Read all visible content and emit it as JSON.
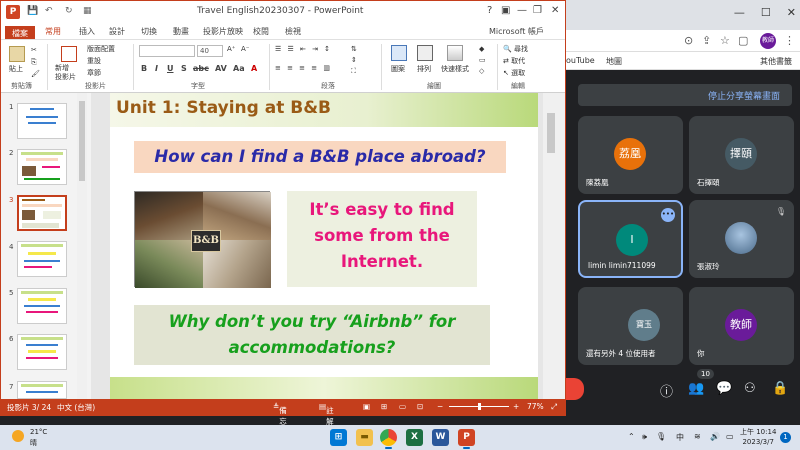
{
  "ppt": {
    "window_title": "Travel English20230307 - PowerPoint",
    "logo": "P",
    "qa_icons": [
      "save-icon",
      "undo-icon",
      "redo-icon",
      "present-icon"
    ],
    "title_help": "?",
    "tabs": [
      "檔案",
      "常用",
      "插入",
      "設計",
      "切換",
      "動畫",
      "投影片放映",
      "校閱",
      "檢視"
    ],
    "account": "Microsoft 帳戶",
    "ribbon": {
      "paste": "貼上",
      "new_slide": "新增\n投影片",
      "layout": "版面配置",
      "reset": "重設",
      "section": "章節",
      "font_size": "40",
      "shapes": "圖案",
      "arrange": "排列",
      "quick_styles": "快速樣式",
      "find": "尋找",
      "replace": "取代",
      "select": "選取",
      "groups": [
        "剪貼簿",
        "投影片",
        "字型",
        "段落",
        "繪圖",
        "編輯"
      ],
      "format_buttons": [
        "B",
        "I",
        "U",
        "S",
        "abc",
        "AV",
        "Aa"
      ]
    },
    "slide_numbers": [
      "1",
      "2",
      "3",
      "4",
      "5",
      "6",
      "7"
    ],
    "slide": {
      "title": "Unit 1: Staying at B&B",
      "question1": "How can I find a B&B place abroad?",
      "answer_line1": "It’s easy to find",
      "answer_line2": "some from the",
      "answer_line3": "Internet.",
      "question2_line1": "Why don’t you try “Airbnb” for",
      "question2_line2": "accommodations?",
      "sign": "B&B"
    },
    "status": {
      "slide_info": "投影片 3/ 24",
      "language": "中文 (台灣)",
      "notes": "備忘稿",
      "comments": "註解",
      "zoom": "77%",
      "zoom_fraction": 0.5
    }
  },
  "meet": {
    "tab_title": "教師",
    "bookmarks": [
      "ouTube",
      "地圖",
      "其他書籤"
    ],
    "stop_share": "停止分享螢幕畫面",
    "participants": [
      {
        "avatar": "荔凰",
        "name": "陳荔凰",
        "color": "#e8710a"
      },
      {
        "avatar": "擇頤",
        "name": "石擇頤",
        "color": "#455a64"
      },
      {
        "avatar": "I",
        "name": "limin limin711099",
        "color": "#00897b"
      },
      {
        "avatar": "",
        "name": "張淑玲",
        "color": "#5d7fa8"
      },
      {
        "avatar": "寶玉",
        "name": "還有另外 4 位使用者",
        "color": "#607d8b"
      },
      {
        "avatar": "教師",
        "name": "你",
        "color": "#6a1b9a"
      }
    ],
    "participant_count": "10"
  },
  "taskbar": {
    "temp": "21°C",
    "weather": "晴",
    "ime": "中",
    "time": "上午 10:14",
    "date": "2023/3/7",
    "notifications": "1"
  }
}
